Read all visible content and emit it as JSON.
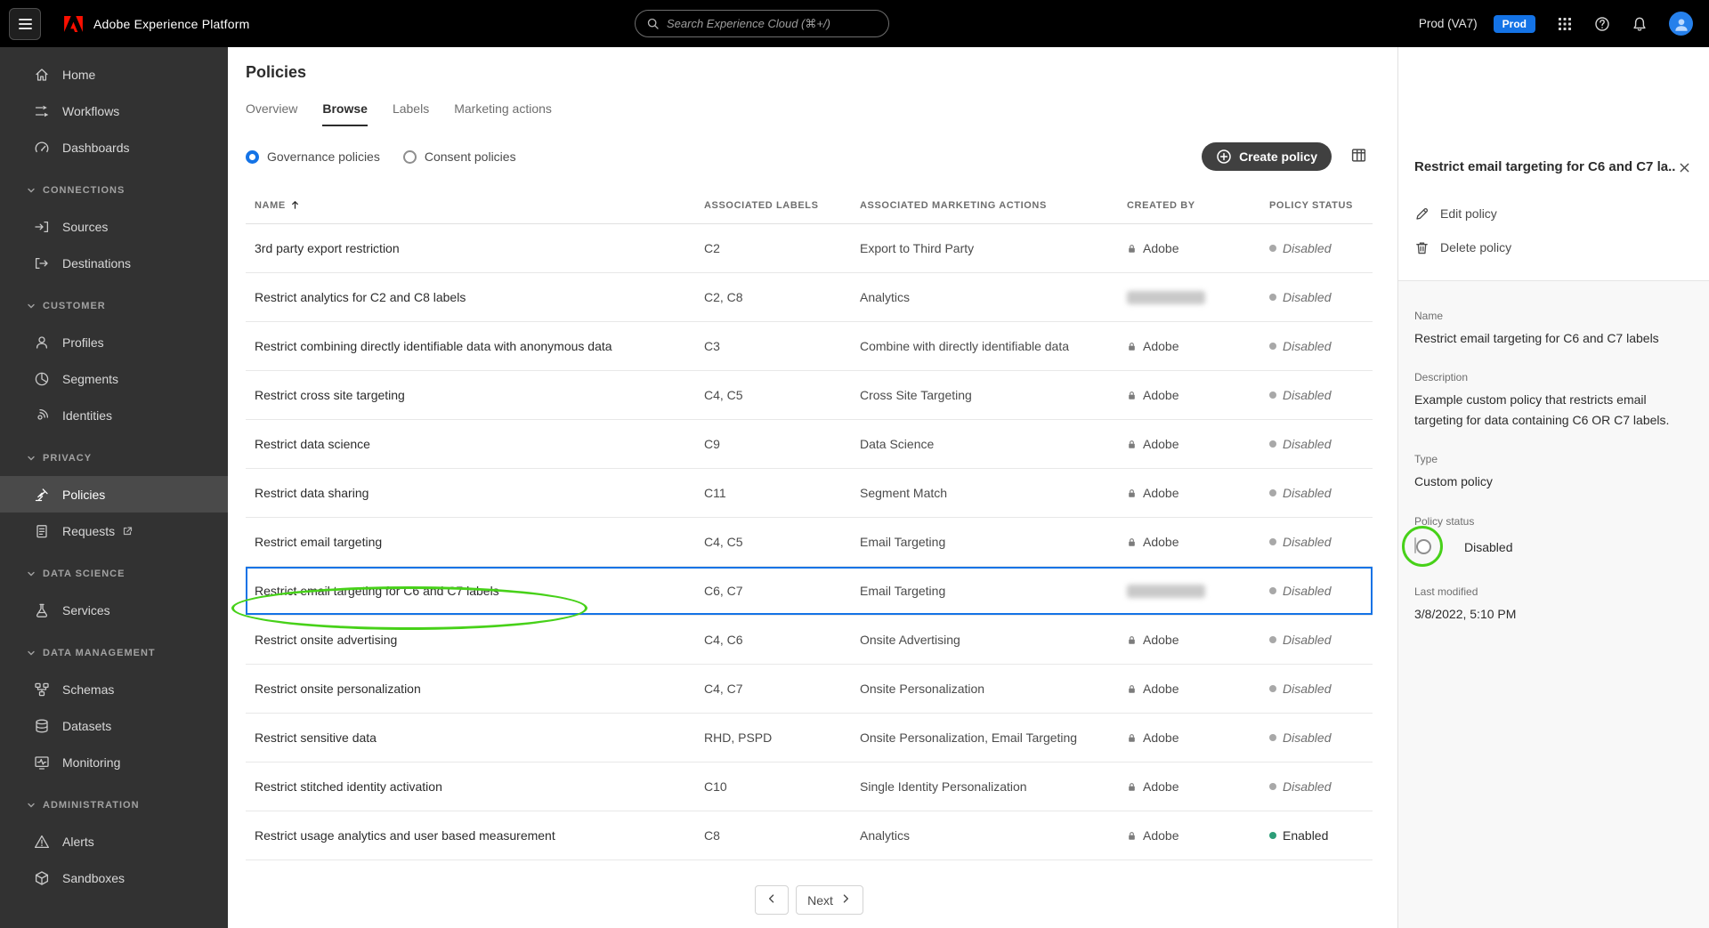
{
  "topbar": {
    "app_title": "Adobe Experience Platform",
    "search_placeholder": "Search Experience Cloud (⌘+/)",
    "environment": "Prod (VA7)",
    "env_badge": "Prod",
    "icons": [
      "hamburger-menu-icon",
      "adobe-logo-icon",
      "search-icon",
      "apps-grid-icon",
      "help-icon",
      "bell-icon",
      "avatar"
    ]
  },
  "sidebar": {
    "items": [
      {
        "label": "Home",
        "icon": "home",
        "type": "item"
      },
      {
        "label": "Workflows",
        "icon": "workflows",
        "type": "item"
      },
      {
        "label": "Dashboards",
        "icon": "dashboards",
        "type": "item"
      },
      {
        "label": "CONNECTIONS",
        "type": "section"
      },
      {
        "label": "Sources",
        "icon": "sources",
        "type": "item"
      },
      {
        "label": "Destinations",
        "icon": "destinations",
        "type": "item"
      },
      {
        "label": "CUSTOMER",
        "type": "section"
      },
      {
        "label": "Profiles",
        "icon": "profiles",
        "type": "item"
      },
      {
        "label": "Segments",
        "icon": "segments",
        "type": "item"
      },
      {
        "label": "Identities",
        "icon": "identities",
        "type": "item"
      },
      {
        "label": "PRIVACY",
        "type": "section"
      },
      {
        "label": "Policies",
        "icon": "policies",
        "type": "item",
        "active": true
      },
      {
        "label": "Requests",
        "icon": "requests",
        "type": "item",
        "external": true
      },
      {
        "label": "DATA SCIENCE",
        "type": "section"
      },
      {
        "label": "Services",
        "icon": "services",
        "type": "item"
      },
      {
        "label": "DATA MANAGEMENT",
        "type": "section"
      },
      {
        "label": "Schemas",
        "icon": "schemas",
        "type": "item"
      },
      {
        "label": "Datasets",
        "icon": "datasets",
        "type": "item"
      },
      {
        "label": "Monitoring",
        "icon": "monitoring",
        "type": "item"
      },
      {
        "label": "ADMINISTRATION",
        "type": "section"
      },
      {
        "label": "Alerts",
        "icon": "alerts",
        "type": "item"
      },
      {
        "label": "Sandboxes",
        "icon": "sandboxes",
        "type": "item"
      }
    ]
  },
  "main": {
    "page_title": "Policies",
    "tabs": [
      {
        "label": "Overview",
        "active": false
      },
      {
        "label": "Browse",
        "active": true
      },
      {
        "label": "Labels",
        "active": false
      },
      {
        "label": "Marketing actions",
        "active": false
      }
    ],
    "filters": {
      "radios": [
        {
          "label": "Governance policies",
          "selected": true
        },
        {
          "label": "Consent policies",
          "selected": false
        }
      ],
      "create_button": "Create policy"
    },
    "table": {
      "columns": [
        "NAME",
        "ASSOCIATED LABELS",
        "ASSOCIATED MARKETING ACTIONS",
        "CREATED BY",
        "POLICY STATUS"
      ],
      "rows": [
        {
          "name": "3rd party export restriction",
          "labels": "C2",
          "marketing_actions": "Export to Third Party",
          "created_by": "Adobe",
          "status": "Disabled"
        },
        {
          "name": "Restrict analytics for C2 and C8 labels",
          "labels": "C2, C8",
          "marketing_actions": "Analytics",
          "created_by": "",
          "redacted": true,
          "status": "Disabled"
        },
        {
          "name": "Restrict combining directly identifiable data with anonymous data",
          "labels": "C3",
          "marketing_actions": "Combine with directly identifiable data",
          "created_by": "Adobe",
          "status": "Disabled"
        },
        {
          "name": "Restrict cross site targeting",
          "labels": "C4, C5",
          "marketing_actions": "Cross Site Targeting",
          "created_by": "Adobe",
          "status": "Disabled"
        },
        {
          "name": "Restrict data science",
          "labels": "C9",
          "marketing_actions": "Data Science",
          "created_by": "Adobe",
          "status": "Disabled"
        },
        {
          "name": "Restrict data sharing",
          "labels": "C11",
          "marketing_actions": "Segment Match",
          "created_by": "Adobe",
          "status": "Disabled"
        },
        {
          "name": "Restrict email targeting",
          "labels": "C4, C5",
          "marketing_actions": "Email Targeting",
          "created_by": "Adobe",
          "status": "Disabled"
        },
        {
          "name": "Restrict email targeting for C6 and C7 labels",
          "labels": "C6, C7",
          "marketing_actions": "Email Targeting",
          "created_by": "",
          "redacted": true,
          "status": "Disabled",
          "selected": true,
          "annotated": true
        },
        {
          "name": "Restrict onsite advertising",
          "labels": "C4, C6",
          "marketing_actions": "Onsite Advertising",
          "created_by": "Adobe",
          "status": "Disabled"
        },
        {
          "name": "Restrict onsite personalization",
          "labels": "C4, C7",
          "marketing_actions": "Onsite Personalization",
          "created_by": "Adobe",
          "status": "Disabled"
        },
        {
          "name": "Restrict sensitive data",
          "labels": "RHD, PSPD",
          "marketing_actions": "Onsite Personalization, Email Targeting",
          "created_by": "Adobe",
          "status": "Disabled"
        },
        {
          "name": "Restrict stitched identity activation",
          "labels": "C10",
          "marketing_actions": "Single Identity Personalization",
          "created_by": "Adobe",
          "status": "Disabled"
        },
        {
          "name": "Restrict usage analytics and user based measurement",
          "labels": "C8",
          "marketing_actions": "Analytics",
          "created_by": "Adobe",
          "status": "Enabled"
        }
      ]
    },
    "pagination": {
      "next_label": "Next"
    }
  },
  "panel": {
    "title": "Restrict email targeting for C6 and C7 la...",
    "edit_label": "Edit policy",
    "delete_label": "Delete policy",
    "name_label": "Name",
    "name_value": "Restrict email targeting for C6 and C7 labels",
    "description_label": "Description",
    "description_value": "Example custom policy that restricts email targeting for data containing C6 OR C7 labels.",
    "type_label": "Type",
    "type_value": "Custom policy",
    "status_label": "Policy status",
    "status_value": "Disabled",
    "modified_label": "Last modified",
    "modified_value": "3/8/2022, 5:10 PM"
  },
  "colors": {
    "accent_blue": "#1473e6",
    "status_enabled": "#2d9d78",
    "status_disabled": "#a8a8a8",
    "annotation_green": "#47d119",
    "topbar_bg": "#000000",
    "sidebar_bg": "#323232"
  }
}
